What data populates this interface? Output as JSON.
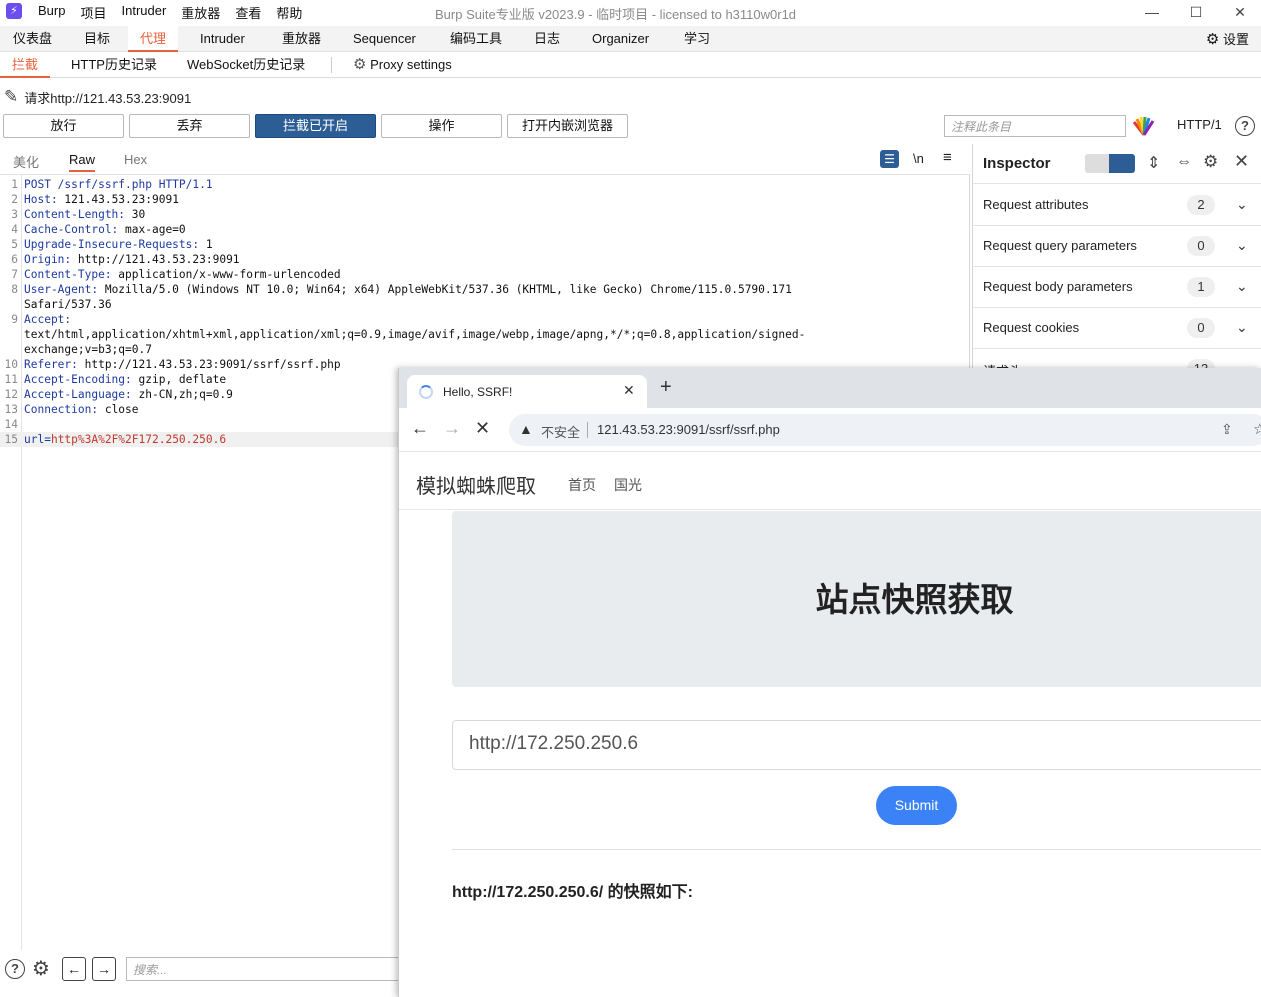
{
  "burp": {
    "app_logo": "⚡",
    "menu": [
      "Burp",
      "项目",
      "Intruder",
      "重放器",
      "查看",
      "帮助"
    ],
    "window_title": "Burp Suite专业版  v2023.9 - 临时项目 - licensed to h3110w0r1d",
    "window_controls": [
      "—",
      "☐",
      "✕"
    ],
    "main_tabs": [
      "仪表盘",
      "目标",
      "代理",
      "Intruder",
      "重放器",
      "Sequencer",
      "编码工具",
      "日志",
      "Organizer",
      "学习"
    ],
    "settings_label": "设置",
    "sub_tabs": [
      "拦截",
      "HTTP历史记录",
      "WebSocket历史记录"
    ],
    "proxy_settings": "Proxy settings",
    "request_to": "请求http://121.43.53.23:9091",
    "buttons": {
      "forward": "放行",
      "drop": "丢弃",
      "intercept": "拦截已开启",
      "action": "操作",
      "browser": "打开内嵌浏览器"
    },
    "note_placeholder": "注释此条目",
    "http_version": "HTTP/1",
    "editor_tabs": [
      "美化",
      "Raw",
      "Hex"
    ],
    "editor_icons": [
      "wrap-icon",
      "newline-icon",
      "menu-icon"
    ],
    "newline_label": "\\n",
    "lines": [
      {
        "n": "1",
        "k": "POST /ssrf/ssrf.php HTTP/1.1",
        "v": ""
      },
      {
        "n": "2",
        "k": "Host:",
        "v": " 121.43.53.23:9091"
      },
      {
        "n": "3",
        "k": "Content-Length:",
        "v": " 30"
      },
      {
        "n": "4",
        "k": "Cache-Control:",
        "v": " max-age=0"
      },
      {
        "n": "5",
        "k": "Upgrade-Insecure-Requests:",
        "v": " 1"
      },
      {
        "n": "6",
        "k": "Origin:",
        "v": " http://121.43.53.23:9091"
      },
      {
        "n": "7",
        "k": "Content-Type:",
        "v": " application/x-www-form-urlencoded"
      },
      {
        "n": "8",
        "k": "User-Agent:",
        "v": " Mozilla/5.0 (Windows NT 10.0; Win64; x64) AppleWebKit/537.36 (KHTML, like Gecko) Chrome/115.0.5790.171"
      },
      {
        "n": "",
        "k": "",
        "v": "Safari/537.36"
      },
      {
        "n": "9",
        "k": "Accept:",
        "v": ""
      },
      {
        "n": "",
        "k": "",
        "v": "text/html,application/xhtml+xml,application/xml;q=0.9,image/avif,image/webp,image/apng,*/*;q=0.8,application/signed-"
      },
      {
        "n": "",
        "k": "",
        "v": "exchange;v=b3;q=0.7"
      },
      {
        "n": "10",
        "k": "Referer:",
        "v": " http://121.43.53.23:9091/ssrf/ssrf.php"
      },
      {
        "n": "11",
        "k": "Accept-Encoding:",
        "v": " gzip, deflate"
      },
      {
        "n": "12",
        "k": "Accept-Language:",
        "v": " zh-CN,zh;q=0.9"
      },
      {
        "n": "13",
        "k": "Connection:",
        "v": " close"
      },
      {
        "n": "14",
        "k": "",
        "v": ""
      },
      {
        "n": "15",
        "k": "url=",
        "v": "http%3A%2F%2F172.250.250.6"
      }
    ],
    "search_placeholder": "搜索...",
    "inspector": {
      "title": "Inspector",
      "rows": [
        {
          "label": "Request attributes",
          "count": "2"
        },
        {
          "label": "Request query parameters",
          "count": "0"
        },
        {
          "label": "Request body parameters",
          "count": "1"
        },
        {
          "label": "Request cookies",
          "count": "0"
        },
        {
          "label": "请求头",
          "count": "13"
        }
      ]
    }
  },
  "browser": {
    "tab_title": "Hello, SSRF!",
    "insecure_label": "不安全",
    "url": "121.43.53.23:9091/ssrf/ssrf.php",
    "site": {
      "brand": "模拟蜘蛛爬取",
      "nav": [
        "首页",
        "国光"
      ],
      "hero_title": "站点快照获取",
      "input_value": "http://172.250.250.6",
      "submit_label": "Submit",
      "result_text": "http://172.250.250.6/ 的快照如下:"
    }
  }
}
